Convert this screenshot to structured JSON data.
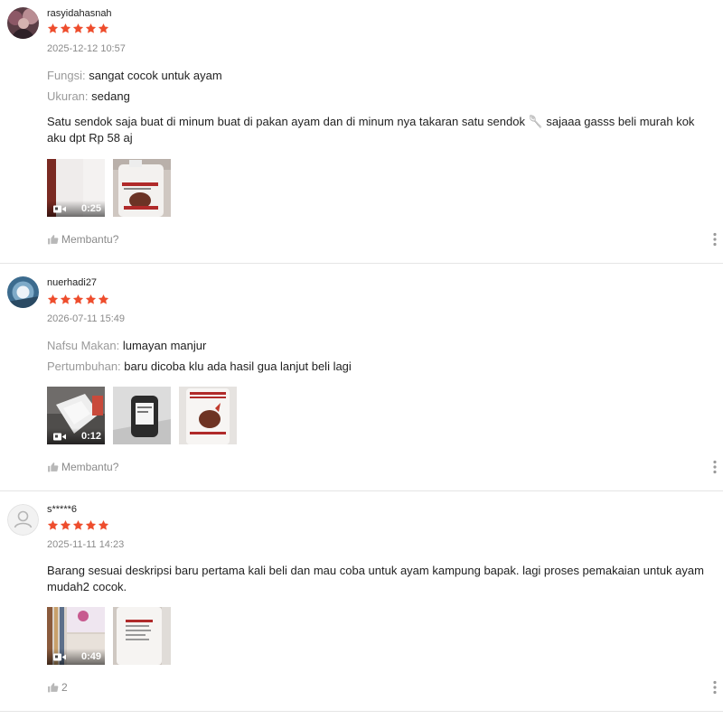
{
  "reviews": [
    {
      "username": "rasyidahasnah",
      "rating": 5,
      "date": "2025-12-12 10:57",
      "attributes": [
        {
          "key": "Fungsi:",
          "value": "sangat cocok untuk ayam"
        },
        {
          "key": "Ukuran:",
          "value": "sedang"
        }
      ],
      "text": "Satu sendok  saja buat di minum  buat di pakan ayam dan di minum nya takaran satu sendok 🥄 sajaaa gasss beli murah kok aku dpt Rp 58 aj",
      "video_duration": "0:25",
      "helpful_label": "Membantu?"
    },
    {
      "username": "nuerhadi27",
      "rating": 5,
      "date": "2026-07-11 15:49",
      "attributes": [
        {
          "key": "Nafsu Makan:",
          "value": "lumayan manjur"
        },
        {
          "key": "Pertumbuhan:",
          "value": "baru dicoba klu ada hasil gua lanjut beli lagi"
        }
      ],
      "text": "",
      "video_duration": "0:12",
      "helpful_label": "Membantu?"
    },
    {
      "username": "s*****6",
      "rating": 5,
      "date": "2025-11-11 14:23",
      "attributes": [],
      "text": "Barang sesuai deskripsi baru pertama kali beli dan mau coba untuk ayam kampung bapak. lagi proses pemakaian untuk ayam mudah2 cocok.",
      "video_duration": "0:49",
      "helpful_label": "2"
    }
  ],
  "colors": {
    "star": "#ee4d2d",
    "muted": "#8a8a8a",
    "divider": "#e5e5e5"
  }
}
